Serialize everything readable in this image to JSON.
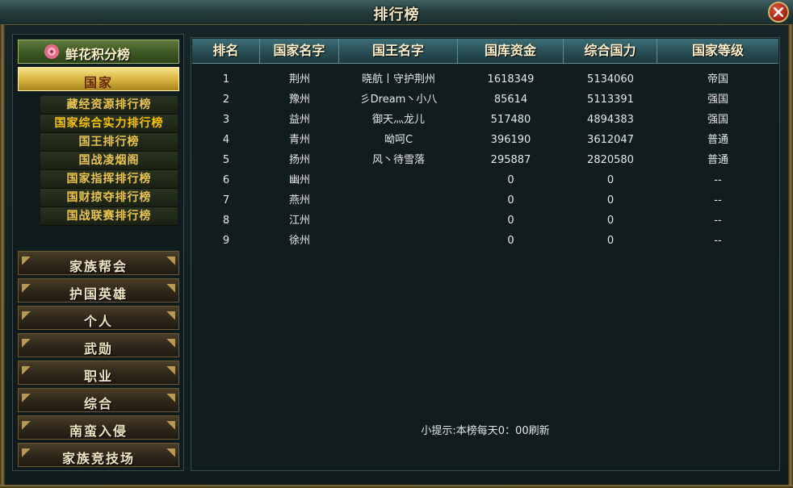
{
  "window": {
    "title": "排行榜"
  },
  "sidebar": {
    "flower_label": "鲜花积分榜",
    "active_category": "国家",
    "sub_items": [
      "藏经资源排行榜",
      "国家综合实力排行榜",
      "国王排行榜",
      "国战凌烟阁",
      "国家指挥排行榜",
      "国财掠夺排行榜",
      "国战联赛排行榜"
    ],
    "categories": [
      "家族帮会",
      "护国英雄",
      "个人",
      "武勋",
      "职业",
      "综合",
      "南蛮入侵",
      "家族竞技场"
    ]
  },
  "table": {
    "headers": [
      "排名",
      "国家名字",
      "国王名字",
      "国库资金",
      "综合国力",
      "国家等级"
    ],
    "rows": [
      [
        "1",
        "荆州",
        "晓航丨守护荆州",
        "1618349",
        "5134060",
        "帝国"
      ],
      [
        "2",
        "豫州",
        "彡Dream丶小八",
        "85614",
        "5113391",
        "强国"
      ],
      [
        "3",
        "益州",
        "御天灬龙儿",
        "517480",
        "4894383",
        "强国"
      ],
      [
        "4",
        "青州",
        "呦呵C",
        "396190",
        "3612047",
        "普通"
      ],
      [
        "5",
        "扬州",
        "风丶待雪落",
        "295887",
        "2820580",
        "普通"
      ],
      [
        "6",
        "幽州",
        "",
        "0",
        "0",
        "--"
      ],
      [
        "7",
        "燕州",
        "",
        "0",
        "0",
        "--"
      ],
      [
        "8",
        "江州",
        "",
        "0",
        "0",
        "--"
      ],
      [
        "9",
        "徐州",
        "",
        "0",
        "0",
        "--"
      ]
    ]
  },
  "hint": "小提示:本榜每天0：00刷新",
  "colors": {
    "accent_gold": "#e9c34e",
    "header_teal": "#2a5058",
    "close_red": "#c0321f"
  }
}
